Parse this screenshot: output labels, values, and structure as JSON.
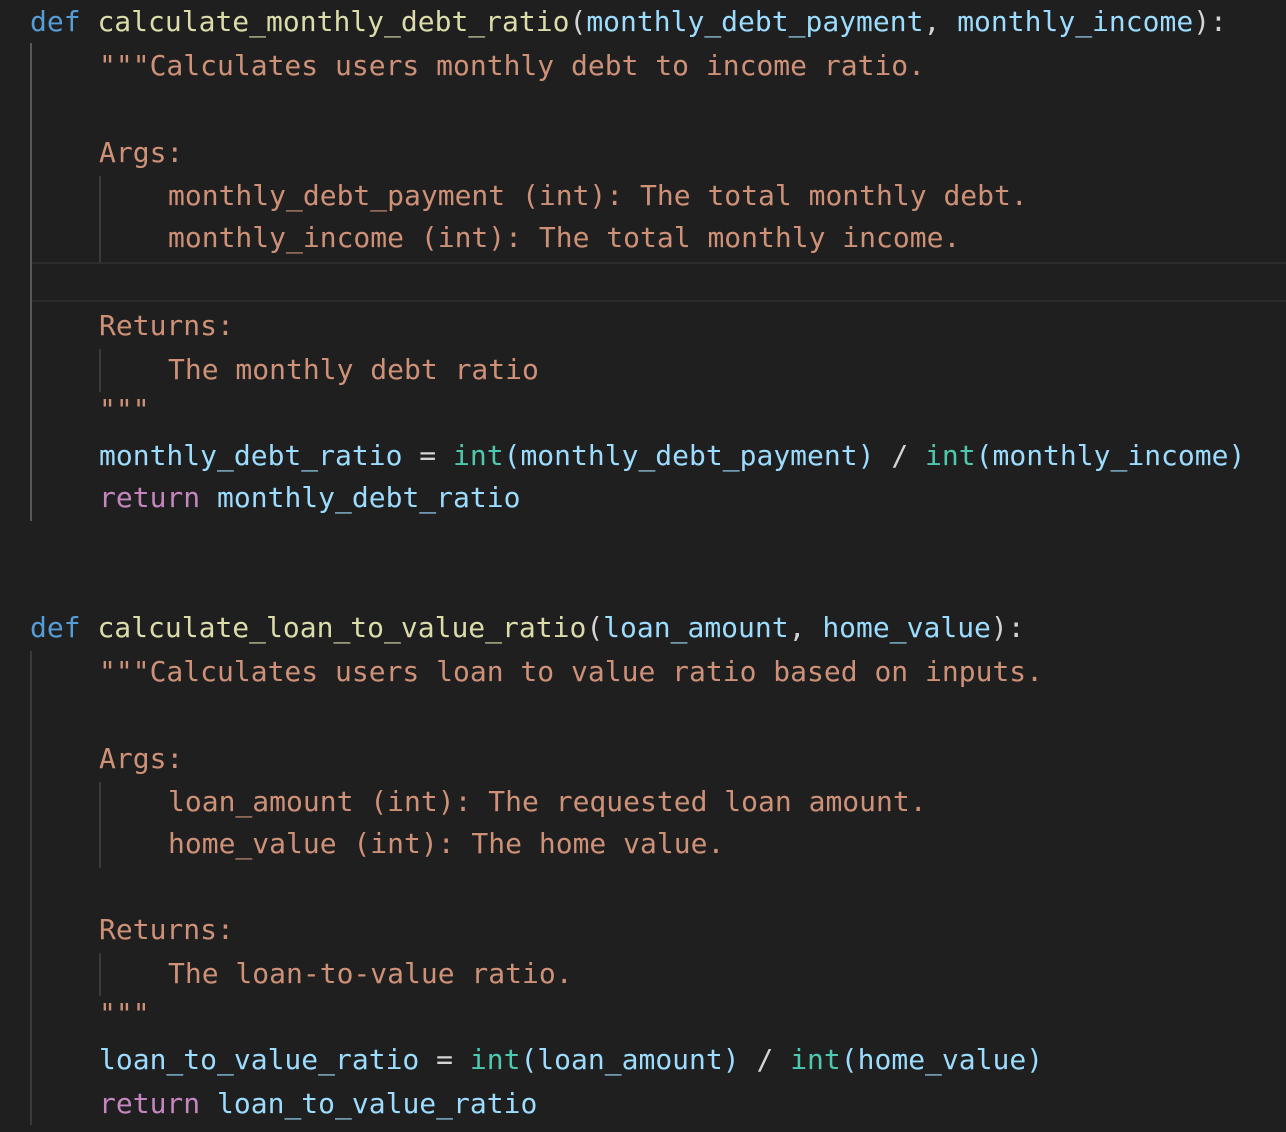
{
  "functions": [
    {
      "def_kw": "def",
      "name": "calculate_monthly_debt_ratio",
      "open_paren": "(",
      "params": [
        "monthly_debt_payment",
        "monthly_income"
      ],
      "sep": ", ",
      "close": "):",
      "doc": {
        "summary": "\"\"\"Calculates users monthly debt to income ratio.",
        "args_header": "Args:",
        "args": [
          "monthly_debt_payment (int): The total monthly debt.",
          "monthly_income (int): The total monthly income."
        ],
        "returns_header": "Returns:",
        "returns_text": "The monthly debt ratio",
        "close": "\"\"\""
      },
      "body": {
        "var": "monthly_debt_ratio",
        "assign": " = ",
        "cast1": "int",
        "arg1": "(monthly_debt_payment)",
        "div": " / ",
        "cast2": "int",
        "arg2": "(monthly_income)",
        "return_kw": "return",
        "return_var": " monthly_debt_ratio"
      }
    },
    {
      "def_kw": "def",
      "name": "calculate_loan_to_value_ratio",
      "open_paren": "(",
      "params": [
        "loan_amount",
        "home_value"
      ],
      "sep": ", ",
      "close": "):",
      "doc": {
        "summary": "\"\"\"Calculates users loan to value ratio based on inputs.",
        "args_header": "Args:",
        "args": [
          "loan_amount (int): The requested loan amount.",
          "home_value (int): The home value."
        ],
        "returns_header": "Returns:",
        "returns_text": "The loan-to-value ratio.",
        "close": "\"\"\""
      },
      "body": {
        "var": "loan_to_value_ratio",
        "assign": " = ",
        "cast1": "int",
        "arg1": "(loan_amount)",
        "div": " / ",
        "cast2": "int",
        "arg2": "(home_value)",
        "return_kw": "return",
        "return_var": " loan_to_value_ratio"
      }
    }
  ]
}
